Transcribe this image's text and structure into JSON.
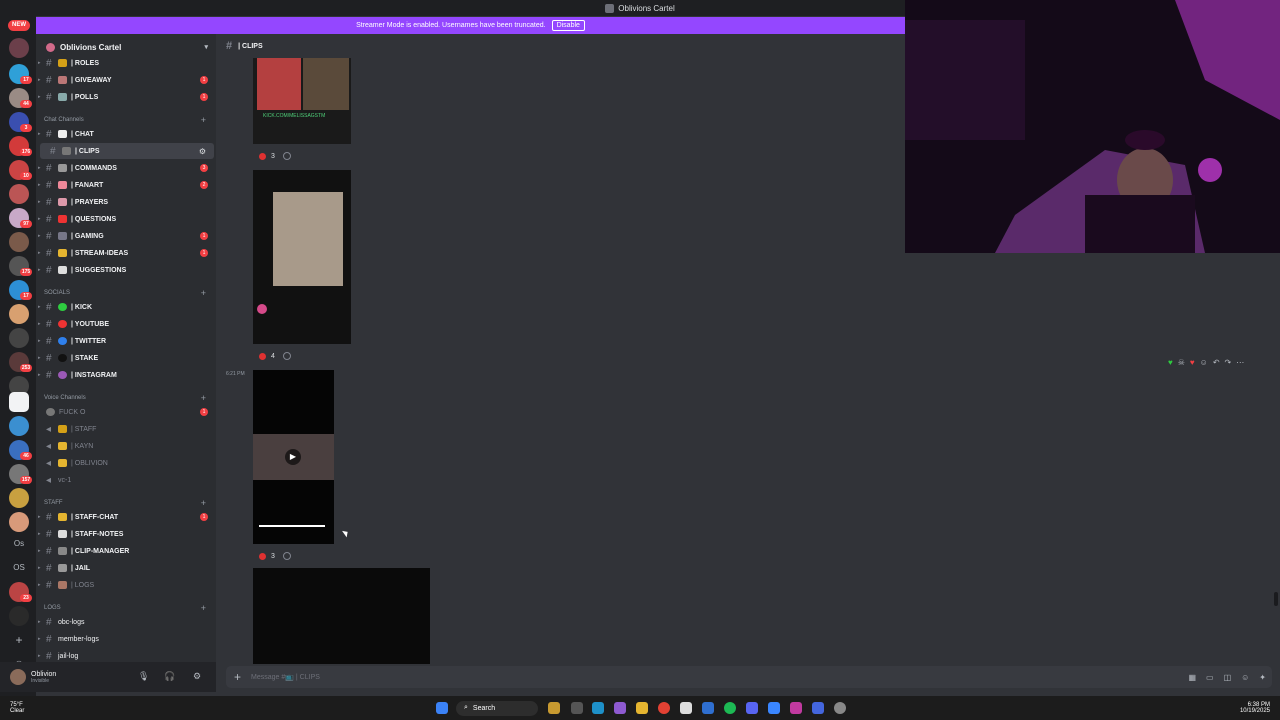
{
  "window": {
    "title": "Oblivions Cartel"
  },
  "banner": {
    "text": "Streamer Mode is enabled. Usernames have been truncated.",
    "disable_label": "Disable"
  },
  "rail": {
    "new_label": "NEW",
    "badges": [
      "17",
      "44",
      "3",
      "176",
      "10",
      "97",
      "175",
      "17",
      "253",
      "46",
      "157",
      "23"
    ],
    "text_icons": [
      "Os",
      "OS"
    ]
  },
  "server": {
    "name": "Oblivions Cartel"
  },
  "channels": {
    "top": [
      {
        "label": "| ROLES",
        "badge": ""
      },
      {
        "label": "| GIVEAWAY",
        "badge": "1"
      },
      {
        "label": "| POLLS",
        "badge": "1"
      }
    ],
    "chat_category": "Chat Channels",
    "chat": [
      {
        "label": "| CHAT",
        "badge": ""
      },
      {
        "label": "| CLIPS",
        "badge": ""
      },
      {
        "label": "| COMMANDS",
        "badge": "3"
      },
      {
        "label": "| FANART",
        "badge": "2"
      },
      {
        "label": "| PRAYERS",
        "badge": ""
      },
      {
        "label": "| QUESTIONS",
        "badge": ""
      },
      {
        "label": "| GAMING",
        "badge": "1"
      },
      {
        "label": "| STREAM-IDEAS",
        "badge": "1"
      },
      {
        "label": "| SUGGESTIONS",
        "badge": ""
      }
    ],
    "socials_category": "SOCIALS",
    "socials": [
      {
        "label": "| KICK",
        "badge": ""
      },
      {
        "label": "| YOUTUBE",
        "badge": ""
      },
      {
        "label": "| TWITTER",
        "badge": ""
      },
      {
        "label": "| STAKE",
        "badge": ""
      },
      {
        "label": "| INSTAGRAM",
        "badge": ""
      }
    ],
    "voice_category": "Voice Channels",
    "voice": [
      {
        "label": "FUCK O",
        "badge": "1"
      },
      {
        "label": "| STAFF",
        "badge": ""
      },
      {
        "label": "| KAYN",
        "badge": ""
      },
      {
        "label": "| OBLIVION",
        "badge": ""
      },
      {
        "label": "vc-1",
        "badge": ""
      }
    ],
    "staff_category": "STAFF",
    "staff": [
      {
        "label": "| STAFF-CHAT",
        "badge": "1"
      },
      {
        "label": "| STAFF-NOTES",
        "badge": ""
      },
      {
        "label": "| CLIP-MANAGER",
        "badge": ""
      },
      {
        "label": "| JAIL",
        "badge": ""
      },
      {
        "label": "| LOGS",
        "badge": ""
      }
    ],
    "logs_category": "LOGS",
    "logs": [
      {
        "label": "obc-logs"
      },
      {
        "label": "member-logs"
      },
      {
        "label": "jail-log"
      }
    ]
  },
  "user": {
    "name": "Oblivion",
    "status": "Invisible"
  },
  "chat": {
    "channel_name": "| CLIPS",
    "clip1_caption": "KICK.COM/MELISSAGSTM",
    "messages": [
      {
        "reaction_count": "3"
      },
      {
        "reaction_count": "4"
      },
      {
        "reaction_count": "3",
        "timestamp": "6:21 PM"
      }
    ],
    "composer_placeholder": "Message #📺 | CLIPS"
  },
  "taskbar": {
    "weather_temp": "75°F",
    "weather_desc": "Clear",
    "search_label": "Search",
    "time": "6:38 PM",
    "date": "10/19/2025"
  }
}
